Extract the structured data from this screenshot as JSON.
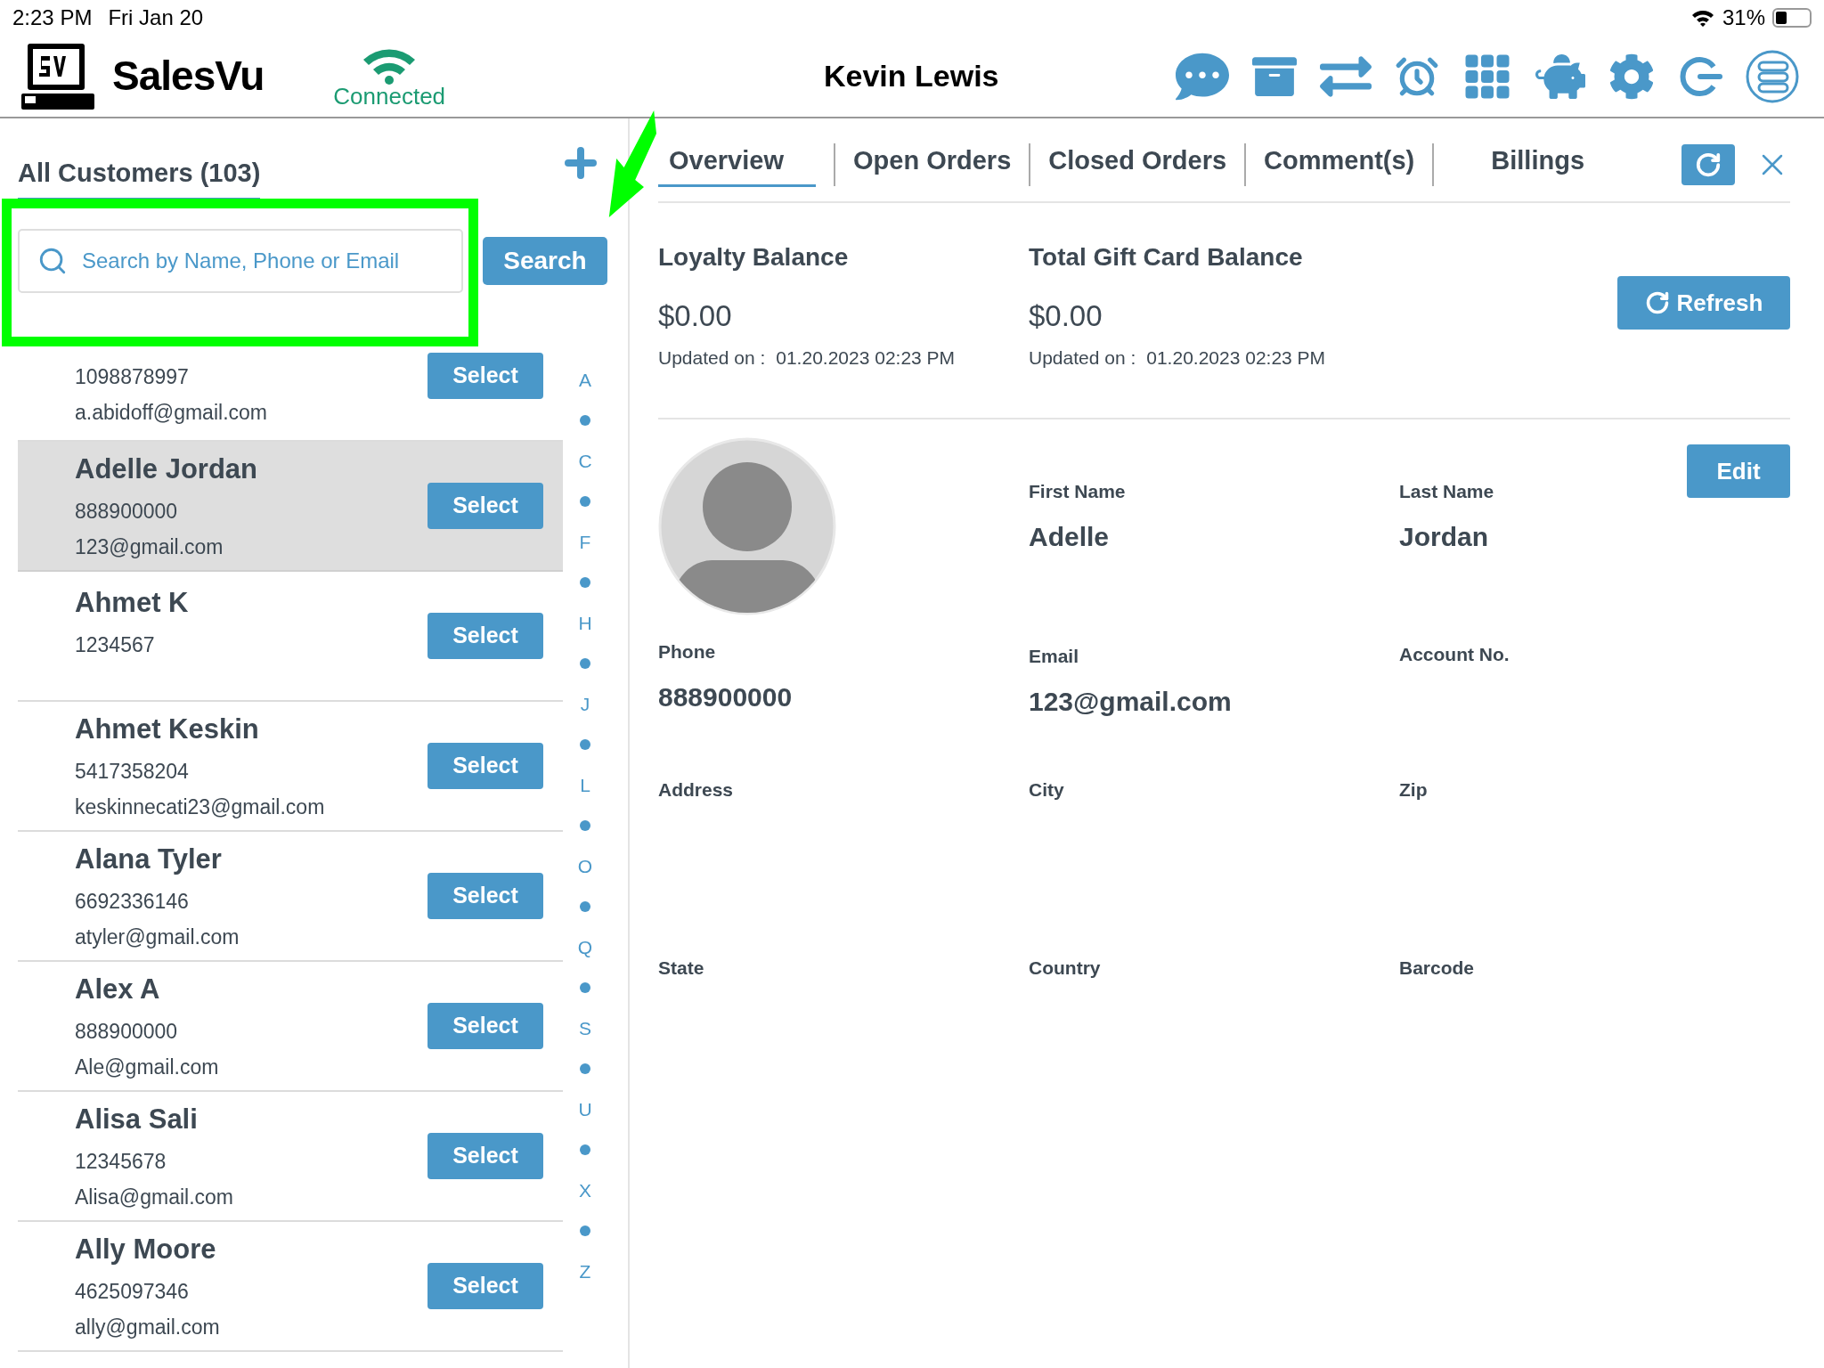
{
  "status_bar": {
    "time": "2:23 PM",
    "date": "Fri Jan 20",
    "battery": "31%"
  },
  "header": {
    "brand": "SalesVu",
    "connection": "Connected",
    "user": "Kevin Lewis"
  },
  "customers_panel": {
    "title": "All Customers (103)",
    "search": {
      "placeholder": "Search by Name, Phone or Email",
      "button": "Search"
    },
    "customers": [
      {
        "phone": "1098878997",
        "email": "a.abidoff@gmail.com",
        "selected": false,
        "button": "Select"
      },
      {
        "name": "Adelle Jordan",
        "phone": "888900000",
        "email": "123@gmail.com",
        "selected": true,
        "button": "Select"
      },
      {
        "name": "Ahmet K",
        "phone": "1234567",
        "selected": false,
        "button": "Select"
      },
      {
        "name": "Ahmet Keskin",
        "phone": "5417358204",
        "email": "keskinnecati23@gmail.com",
        "selected": false,
        "button": "Select"
      },
      {
        "name": "Alana Tyler",
        "phone": "6692336146",
        "email": "atyler@gmail.com",
        "selected": false,
        "button": "Select"
      },
      {
        "name": "Alex A",
        "phone": "888900000",
        "email": "Ale@gmail.com",
        "selected": false,
        "button": "Select"
      },
      {
        "name": "Alisa Sali",
        "phone": "12345678",
        "email": "Alisa@gmail.com",
        "selected": false,
        "button": "Select"
      },
      {
        "name": "Ally Moore",
        "phone": "4625097346",
        "email": "ally@gmail.com",
        "selected": false,
        "button": "Select"
      }
    ],
    "alphabet": [
      "A",
      "C",
      "F",
      "H",
      "J",
      "L",
      "O",
      "Q",
      "S",
      "U",
      "X",
      "Z"
    ]
  },
  "detail": {
    "tabs": [
      {
        "label": "Overview",
        "selected": true
      },
      {
        "label": "Open Orders",
        "selected": false
      },
      {
        "label": "Closed Orders",
        "selected": false
      },
      {
        "label": "Comment(s)",
        "selected": false
      },
      {
        "label": "Billings",
        "selected": false
      }
    ],
    "balances": [
      {
        "label": "Loyalty Balance",
        "amount": "$0.00",
        "updated_label": "Updated on :",
        "updated": "01.20.2023 02:23 PM"
      },
      {
        "label": "Total Gift Card Balance",
        "amount": "$0.00",
        "updated_label": "Updated on :",
        "updated": "01.20.2023 02:23 PM"
      }
    ],
    "refresh_button": "Refresh",
    "edit_button": "Edit",
    "fields": [
      {
        "label": "First Name",
        "value": "Adelle"
      },
      {
        "label": "Last Name",
        "value": "Jordan"
      },
      {
        "label": "Phone",
        "value": "888900000"
      },
      {
        "label": "Email",
        "value": "123@gmail.com"
      },
      {
        "label": "Account No."
      },
      {
        "label": "Address"
      },
      {
        "label": "City"
      },
      {
        "label": "Zip"
      },
      {
        "label": "State"
      },
      {
        "label": "Country"
      },
      {
        "label": "Barcode"
      }
    ]
  }
}
